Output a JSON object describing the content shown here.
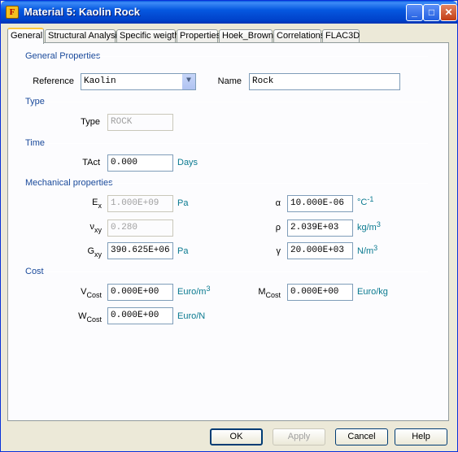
{
  "window": {
    "title": "Material 5: Kaolin Rock",
    "icon": "app-logo-icon",
    "controls": [
      "minimize-icon",
      "maximize-icon",
      "close-icon"
    ]
  },
  "tabs": [
    "General",
    "Structural Analysis",
    "Specific weigth",
    "Properties",
    "Hoek_Brown",
    "Correlations",
    "FLAC3D"
  ],
  "active_tab": "General",
  "general": {
    "title": "General Properties",
    "reference_label": "Reference",
    "reference_value": "Kaolin",
    "name_label": "Name",
    "name_value": "Rock"
  },
  "type": {
    "title": "Type",
    "label": "Type",
    "value": "ROCK"
  },
  "time": {
    "title": "Time",
    "label": "TAct",
    "value": "0.000",
    "unit": "Days"
  },
  "mechanical": {
    "title": "Mechanical properties",
    "ex": {
      "label": "E",
      "sub": "x",
      "value": "1.000E+09",
      "unit": "Pa"
    },
    "vxy": {
      "label": "ν",
      "sub": "xy",
      "value": "0.280"
    },
    "gxy": {
      "label": "G",
      "sub": "xy",
      "value": "390.625E+06",
      "unit": "Pa"
    },
    "alpha": {
      "label": "α",
      "value": "10.000E-06",
      "unit": "°C",
      "unit_sup": "-1"
    },
    "rho": {
      "label": "ρ",
      "value": "2.039E+03",
      "unit": "kg/m",
      "unit_sup": "3"
    },
    "gamma": {
      "label": "γ",
      "value": "20.000E+03",
      "unit": "N/m",
      "unit_sup": "3"
    }
  },
  "cost": {
    "title": "Cost",
    "vcost": {
      "label": "V",
      "sub": "Cost",
      "value": "0.000E+00",
      "unit": "Euro/m",
      "unit_sup": "3"
    },
    "mcost": {
      "label": "M",
      "sub": "Cost",
      "value": "0.000E+00",
      "unit": "Euro/kg"
    },
    "wcost": {
      "label": "W",
      "sub": "Cost",
      "value": "0.000E+00",
      "unit": "Euro/N"
    }
  },
  "buttons": {
    "ok": "OK",
    "apply": "Apply",
    "cancel": "Cancel",
    "help": "Help"
  }
}
